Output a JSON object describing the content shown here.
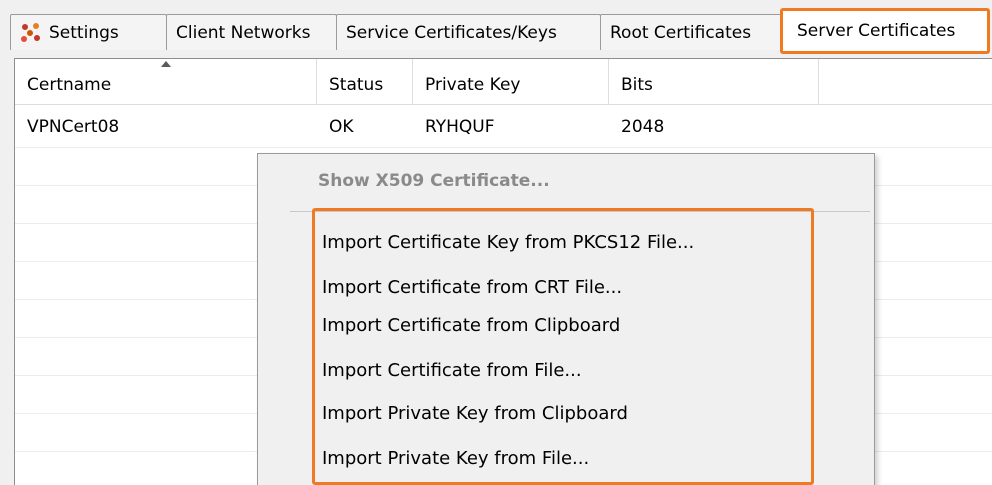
{
  "tabs": [
    {
      "id": "settings",
      "label": "Settings",
      "icon": "network-settings-icon",
      "active": false
    },
    {
      "id": "client-networks",
      "label": "Client Networks",
      "active": false
    },
    {
      "id": "service-certificates",
      "label": "Service Certificates/Keys",
      "active": false
    },
    {
      "id": "root-certificates",
      "label": "Root Certificates",
      "active": false
    },
    {
      "id": "server-certificates",
      "label": "Server Certificates",
      "active": true
    }
  ],
  "table": {
    "columns": [
      "Certname",
      "Status",
      "Private Key",
      "Bits"
    ],
    "sorted_column": "Certname",
    "sort_direction": "ascending",
    "rows": [
      {
        "certname": "VPNCert08",
        "status": "OK",
        "private_key": "RYHQUF",
        "bits": "2048"
      }
    ]
  },
  "context_menu": {
    "disabled_item": "Show X509 Certificate...",
    "items": [
      "Import Certificate  Key from PKCS12 File...",
      "Import Certificate from CRT File...",
      "Import Certificate from Clipboard",
      "Import Certificate from File...",
      "Import Private Key from Clipboard",
      "Import Private Key from File..."
    ]
  },
  "colors": {
    "highlight": "#f07a21",
    "panel_background": "#f0f0f0",
    "grid_background": "#ffffff"
  }
}
